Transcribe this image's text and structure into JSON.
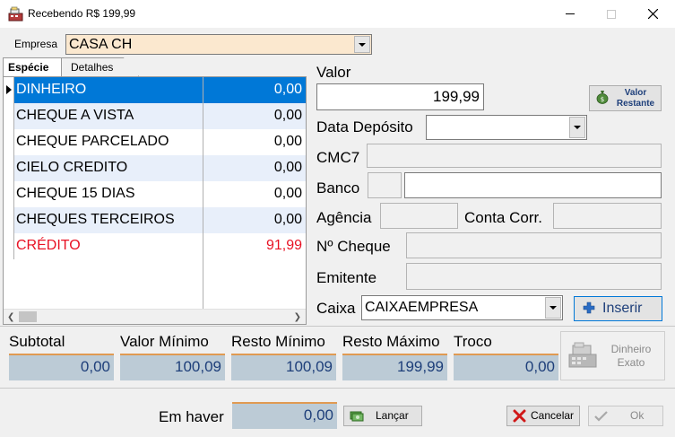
{
  "window": {
    "title": "Recebendo R$ 199,99",
    "icon": "cash-register-icon"
  },
  "empresa": {
    "label": "Empresa",
    "value": "CASA CH"
  },
  "tabs": [
    {
      "label": "Espécie",
      "active": true
    },
    {
      "label": "Detalhes",
      "active": false
    }
  ],
  "grid": {
    "rows": [
      {
        "name": "DINHEIRO",
        "value": "0,00",
        "selected": true
      },
      {
        "name": "CHEQUE A VISTA",
        "value": "0,00"
      },
      {
        "name": "CHEQUE PARCELADO",
        "value": "0,00"
      },
      {
        "name": "CIELO CREDITO",
        "value": "0,00"
      },
      {
        "name": "CHEQUE 15 DIAS",
        "value": "0,00"
      },
      {
        "name": "CHEQUES TERCEIROS",
        "value": "0,00"
      },
      {
        "name": "CRÉDITO",
        "value": "91,99",
        "color": "#e81123"
      }
    ]
  },
  "form": {
    "valor_label": "Valor",
    "valor_value": "199,99",
    "valor_restante_label": "Valor Restante",
    "data_deposito_label": "Data Depósito",
    "data_deposito_value": "",
    "cmc7_label": "CMC7",
    "banco_label": "Banco",
    "agencia_label": "Agência",
    "conta_label": "Conta Corr.",
    "ncheque_label": "Nº Cheque",
    "emitente_label": "Emitente",
    "caixa_label": "Caixa",
    "caixa_value": "CAIXAEMPRESA",
    "inserir_label": "Inserir"
  },
  "summary": {
    "subtotal_label": "Subtotal",
    "subtotal_value": "0,00",
    "valor_minimo_label": "Valor Mínimo",
    "valor_minimo_value": "100,09",
    "resto_minimo_label": "Resto Mínimo",
    "resto_minimo_value": "100,09",
    "resto_maximo_label": "Resto Máximo",
    "resto_maximo_value": "199,99",
    "troco_label": "Troco",
    "troco_value": "0,00",
    "dinheiro_exato_label": "Dinheiro Exato"
  },
  "footer": {
    "em_haver_label": "Em haver",
    "em_haver_value": "0,00",
    "lancar_label": "Lançar",
    "cancelar_label": "Cancelar",
    "ok_label": "Ok"
  },
  "colors": {
    "selection": "#0078d7",
    "credit_text": "#e81123",
    "summary_box": "#bccbd6",
    "summary_accent": "#e09a52",
    "empresa_bg": "#fbe8cf"
  }
}
